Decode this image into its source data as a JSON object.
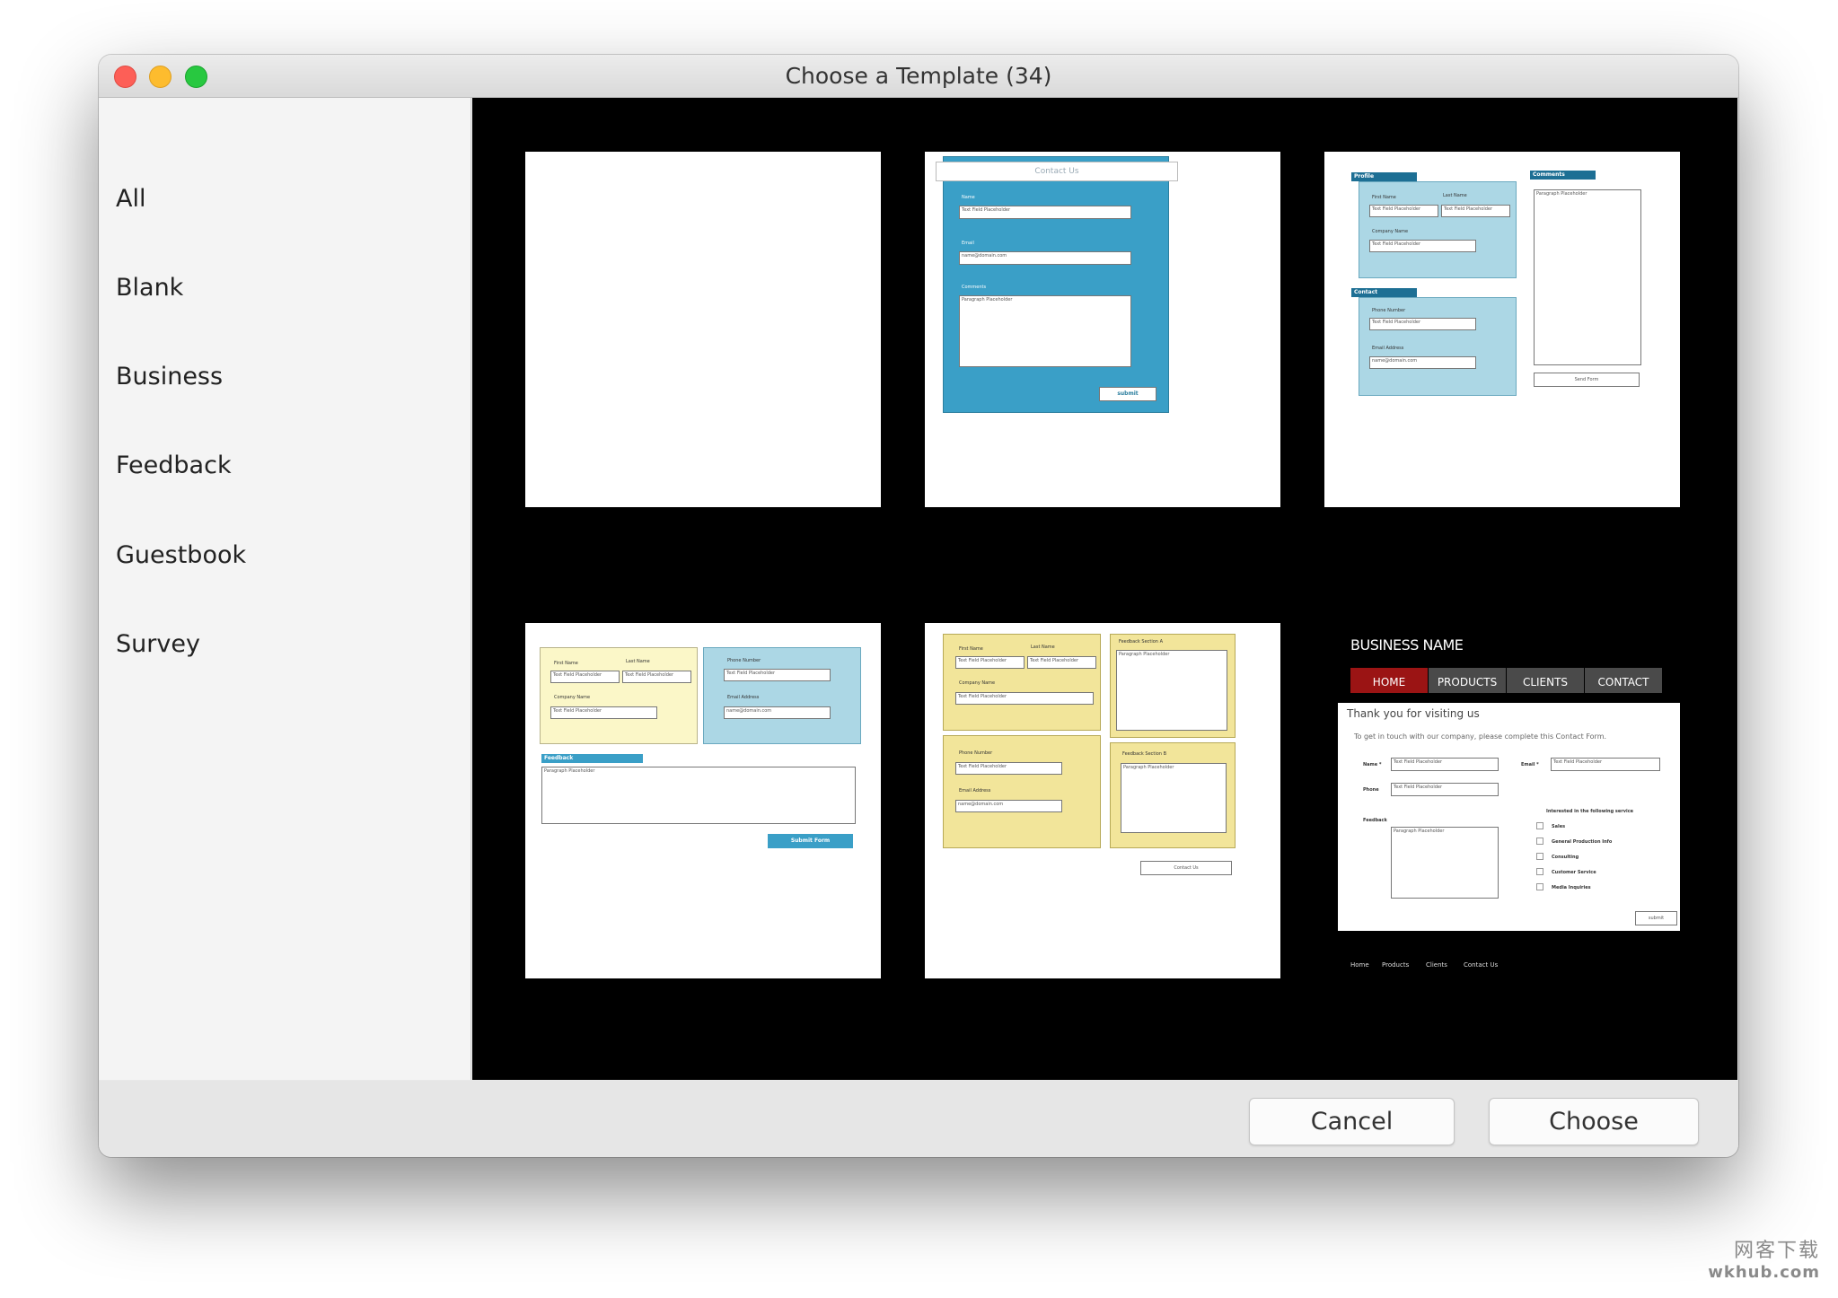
{
  "window": {
    "title": "Choose a Template (34)"
  },
  "sidebar": {
    "items": [
      {
        "label": "All"
      },
      {
        "label": "Blank"
      },
      {
        "label": "Business"
      },
      {
        "label": "Feedback"
      },
      {
        "label": "Guestbook"
      },
      {
        "label": "Survey"
      }
    ]
  },
  "templates": {
    "t2": {
      "header": "Contact Us",
      "name_label": "Name",
      "name_value": "Text Field Placeholder",
      "email_label": "Email",
      "email_value": "name@domain.com",
      "comments_label": "Comments",
      "comments_value": "Paragraph Placeholder",
      "submit": "submit"
    },
    "t3": {
      "profile": "Profile",
      "first_name": "First Name",
      "last_name": "Last Name",
      "field1": "Text Field Placeholder",
      "field2": "Text Field Placeholder",
      "company": "Company Name",
      "field3": "Text Field Placeholder",
      "comments": "Comments",
      "paragraph": "Paragraph Placeholder",
      "contact": "Contact",
      "phone": "Phone Number",
      "field4": "Text Field Placeholder",
      "email": "Email Address",
      "email_value": "name@domain.com",
      "send": "Send Form"
    },
    "t4": {
      "first_name": "First Name",
      "last_name": "Last Name",
      "field1": "Text Field Placeholder",
      "field2": "Text Field Placeholder",
      "company": "Company Name",
      "field3": "Text Field Placeholder",
      "phone": "Phone Number",
      "field4": "Text Field Placeholder",
      "email": "Email Address",
      "email_value": "name@domain.com",
      "feedback": "Feedback",
      "paragraph": "Paragraph Placeholder",
      "submit": "Submit Form"
    },
    "t5": {
      "first_name": "First Name",
      "last_name": "Last Name",
      "field1": "Text Field Placeholder",
      "field2": "Text Field Placeholder",
      "company": "Company Name",
      "field3": "Text Field Placeholder",
      "section_a": "Feedback Section A",
      "paragraph_a": "Paragraph Placeholder",
      "phone": "Phone Number",
      "field4": "Text Field Placeholder",
      "email": "Email Address",
      "email_value": "name@domain.com",
      "section_b": "Feedback Section B",
      "paragraph_b": "Paragraph Placeholder",
      "contact": "Contact Us"
    },
    "t6": {
      "business_name": "BUSINESS NAME",
      "nav": [
        "HOME",
        "PRODUCTS",
        "CLIENTS",
        "CONTACT"
      ],
      "heading": "Thank you for visiting us",
      "intro": "To get in touch with our company, please complete this Contact Form.",
      "name_label": "Name *",
      "name_value": "Text Field Placeholder",
      "email_label": "Email *",
      "email_value": "Text Field Placeholder",
      "phone_label": "Phone",
      "phone_value": "Text Field Placeholder",
      "feedback_label": "Feedback",
      "paragraph": "Paragraph Placeholder",
      "interested": "Interested in the following service",
      "options": [
        "Sales",
        "General Production Info",
        "Consulting",
        "Customer Service",
        "Media Inquiries"
      ],
      "submit": "submit",
      "footer_links": [
        "Home",
        "Products",
        "Clients",
        "Contact Us"
      ]
    }
  },
  "footer": {
    "cancel": "Cancel",
    "choose": "Choose"
  },
  "watermark": {
    "line1": "网客下载",
    "line2": "wkhub.com"
  }
}
